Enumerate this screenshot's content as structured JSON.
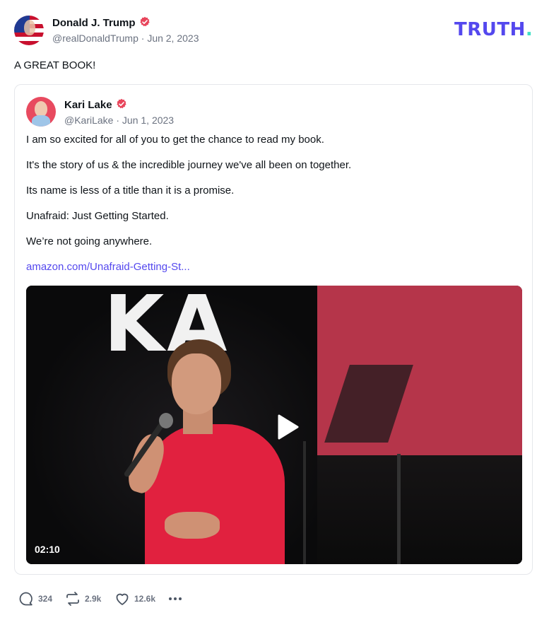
{
  "post": {
    "author_name": "Donald J. Trump",
    "handle": "@realDonaldTrump",
    "separator": " · ",
    "date": "Jun 2, 2023",
    "text": "A GREAT BOOK!",
    "brand": "TRUTH",
    "brand_dot": "."
  },
  "quote": {
    "author_name": "Kari Lake",
    "handle": "@KariLake",
    "separator": " · ",
    "date": "Jun 1, 2023",
    "lines": [
      "I am so excited for all of you to get the chance to read my book.",
      "It's the story of us & the incredible journey we've all been on together.",
      "Its name is less of a title than it is a promise.",
      "Unafraid: Just Getting Started.",
      "We’re not going anywhere."
    ],
    "link": "amazon.com/Unafraid-Getting-St...",
    "video": {
      "duration": "02:10",
      "banner_text": "KA"
    }
  },
  "actions": {
    "replies": "324",
    "retruths": "2.9k",
    "likes": "12.6k"
  },
  "colors": {
    "brand": "#5448ee",
    "brand_dot": "#3fe0c5",
    "verified": "#e8455b",
    "link": "#5448ee"
  },
  "icons": {
    "verified": "verified-badge-icon",
    "play": "play-icon",
    "reply": "comment-icon",
    "retruth": "retruth-icon",
    "like": "heart-icon",
    "more": "more-dots-icon"
  }
}
